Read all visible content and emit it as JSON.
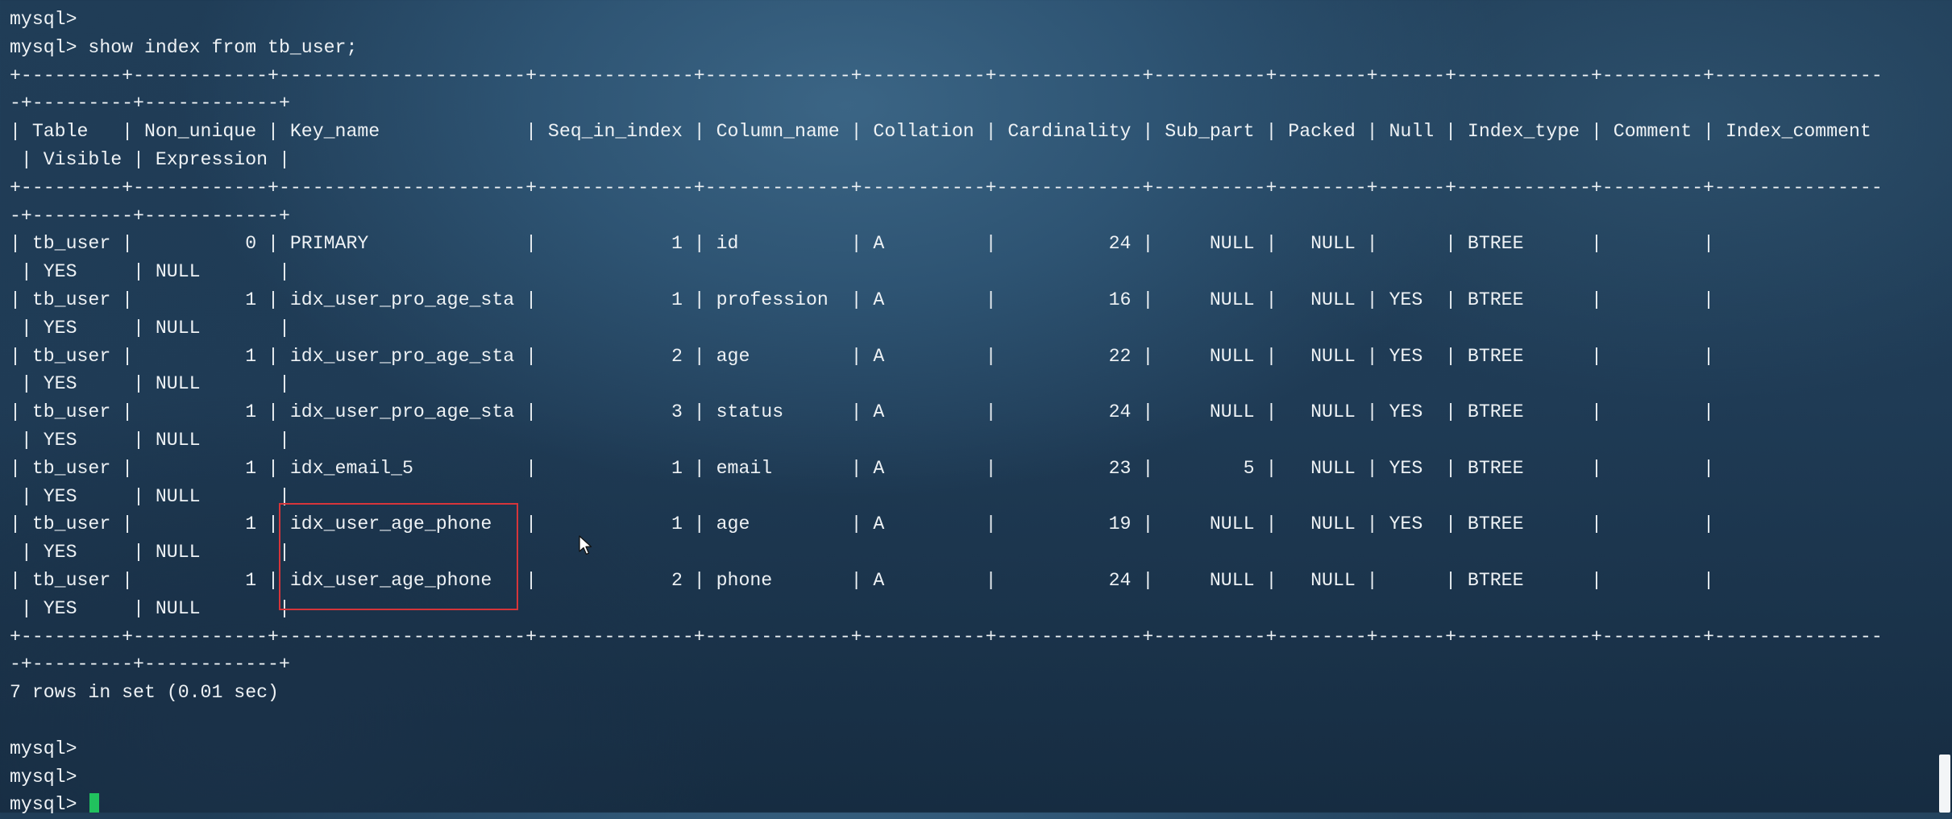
{
  "terminal": {
    "lines": [
      "mysql>",
      "mysql> show index from tb_user;",
      "+---------+------------+----------------------+--------------+-------------+-----------+-------------+----------+--------+------+------------+---------+---------------",
      "-+---------+------------+",
      "| Table   | Non_unique | Key_name             | Seq_in_index | Column_name | Collation | Cardinality | Sub_part | Packed | Null | Index_type | Comment | Index_comment",
      " | Visible | Expression |",
      "+---------+------------+----------------------+--------------+-------------+-----------+-------------+----------+--------+------+------------+---------+---------------",
      "-+---------+------------+",
      "| tb_user |          0 | PRIMARY              |            1 | id          | A         |          24 |     NULL |   NULL |      | BTREE      |         |",
      " | YES     | NULL       |",
      "| tb_user |          1 | idx_user_pro_age_sta |            1 | profession  | A         |          16 |     NULL |   NULL | YES  | BTREE      |         |",
      " | YES     | NULL       |",
      "| tb_user |          1 | idx_user_pro_age_sta |            2 | age         | A         |          22 |     NULL |   NULL | YES  | BTREE      |         |",
      " | YES     | NULL       |",
      "| tb_user |          1 | idx_user_pro_age_sta |            3 | status      | A         |          24 |     NULL |   NULL | YES  | BTREE      |         |",
      " | YES     | NULL       |",
      "| tb_user |          1 | idx_email_5          |            1 | email       | A         |          23 |        5 |   NULL | YES  | BTREE      |         |",
      " | YES     | NULL       |",
      "| tb_user |          1 | idx_user_age_phone   |            1 | age         | A         |          19 |     NULL |   NULL | YES  | BTREE      |         |",
      " | YES     | NULL       |",
      "| tb_user |          1 | idx_user_age_phone   |            2 | phone       | A         |          24 |     NULL |   NULL |      | BTREE      |         |",
      " | YES     | NULL       |",
      "+---------+------------+----------------------+--------------+-------------+-----------+-------------+----------+--------+------+------------+---------+---------------",
      "-+---------+------------+",
      "7 rows in set (0.01 sec)",
      "",
      "mysql>",
      "mysql>"
    ],
    "prompt": "mysql> "
  },
  "colors": {
    "text": "#eef2f5",
    "cursor": "#21c25e",
    "highlight_box": "#d6353a",
    "background": "#1f3b55"
  },
  "icons": {
    "cursor": "block-cursor",
    "pointer": "mouse-pointer-icon"
  }
}
